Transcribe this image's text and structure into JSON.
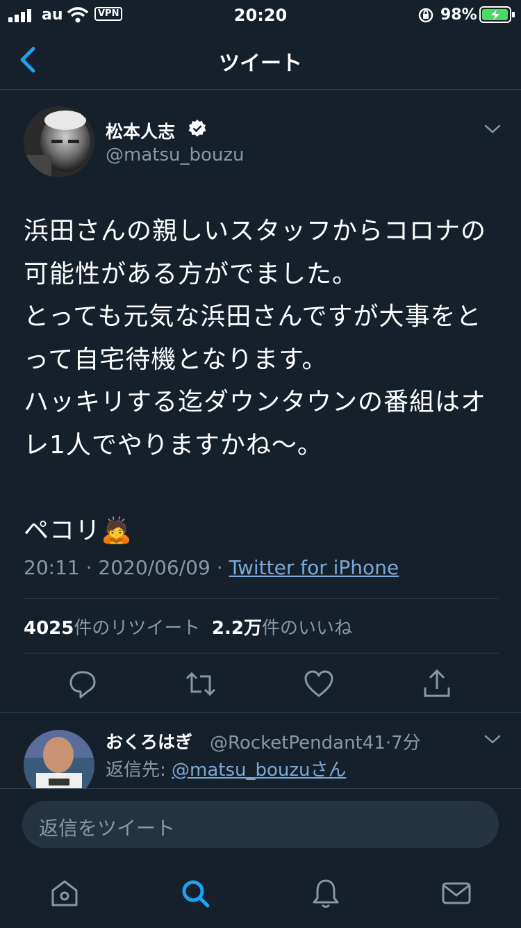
{
  "status_bar": {
    "carrier": "au",
    "vpn": "VPN",
    "time": "20:20",
    "battery": "98%"
  },
  "header": {
    "title": "ツイート"
  },
  "tweet": {
    "author_name": "松本人志",
    "author_handle": "@matsu_bouzu",
    "text": "浜田さんの親しいスタッフからコロナの可能性がある方がでました。\nとっても元気な浜田さんですが大事をとって自宅待機となります。\nハッキリする迄ダウンタウンの番組はオレ1人でやりますかね〜。\n\nペコリ🙇",
    "time": "20:11",
    "date": "2020/06/09",
    "source": "Twitter for iPhone",
    "retweet_count": "4025",
    "retweet_label": "件のリツイート",
    "like_count": "2.2万",
    "like_label": "件のいいね"
  },
  "reply": {
    "author_name": "おくろはぎ",
    "author_handle": "@RocketPendant41",
    "age": "7分",
    "reply_to_label": "返信先: ",
    "reply_to_mention": "@matsu_bouzuさん"
  },
  "compose": {
    "placeholder": "返信をツイート"
  },
  "icons": [
    "back-icon",
    "verified-icon",
    "chevron-down-icon",
    "reply-icon",
    "retweet-icon",
    "like-icon",
    "share-icon",
    "home-icon",
    "search-icon",
    "notifications-icon",
    "messages-icon"
  ],
  "colors": {
    "background": "#15202b",
    "accent": "#1da1f2",
    "link": "#7aa9d8",
    "secondary": "#8899a6",
    "divider": "#38444d"
  }
}
